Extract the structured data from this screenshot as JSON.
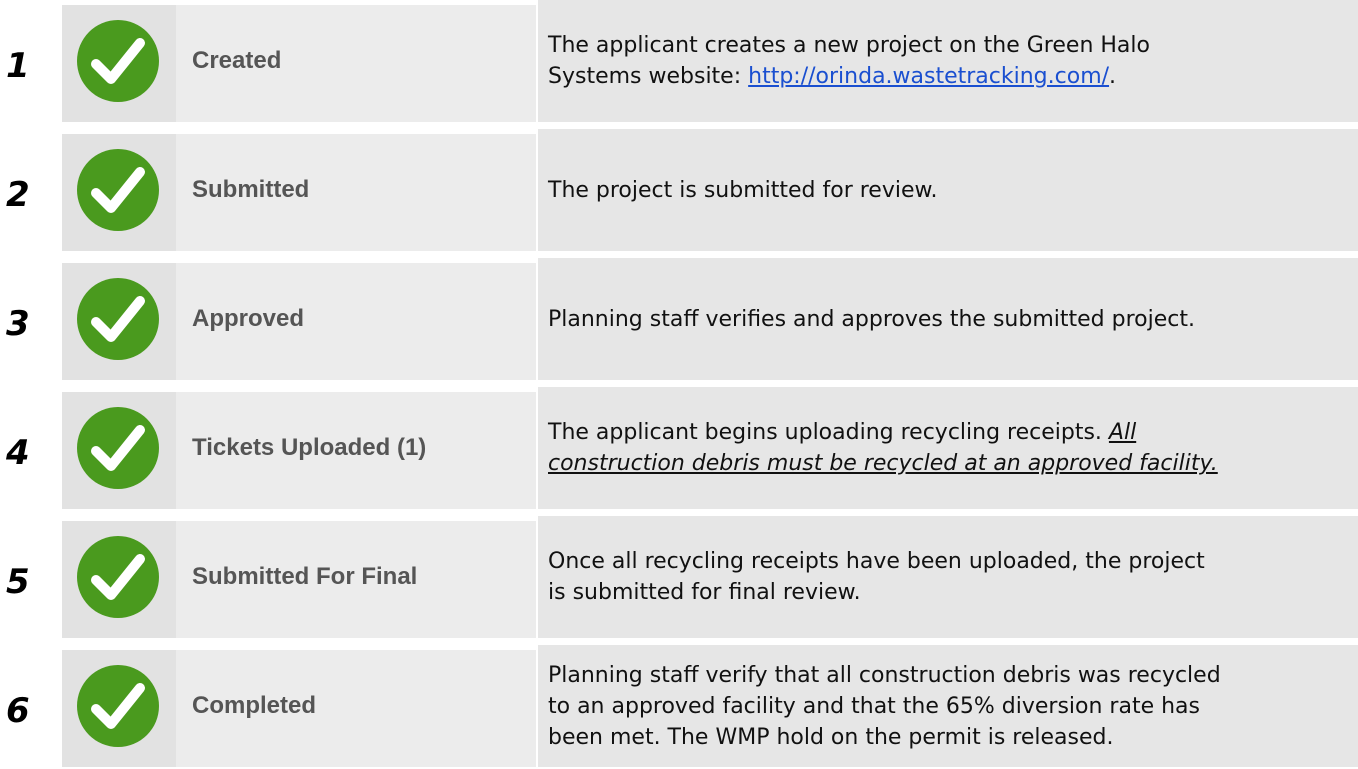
{
  "steps": [
    {
      "number": "1",
      "status": "Created",
      "description": {
        "line1": "The applicant creates a new project on the Green Halo",
        "line2_prefix": "Systems website: ",
        "link": "http://orinda.wastetracking.com/",
        "line2_suffix": "."
      }
    },
    {
      "number": "2",
      "status": "Submitted",
      "description": {
        "line1": "The project is submitted for review."
      }
    },
    {
      "number": "3",
      "status": "Approved",
      "description": {
        "line1": "Planning staff verifies and approves the submitted project."
      }
    },
    {
      "number": "4",
      "status": "Tickets Uploaded (1)",
      "description": {
        "line1_prefix": "The applicant begins uploading recycling receipts. ",
        "line1_emph": "All",
        "line2_emph": "construction debris must be recycled at an approved facility."
      }
    },
    {
      "number": "5",
      "status": "Submitted For Final",
      "description": {
        "line1": "Once all recycling receipts have been uploaded, the project",
        "line2": "is submitted for final review."
      }
    },
    {
      "number": "6",
      "status": "Completed",
      "description": {
        "line1": "Planning staff verify that all construction debris was recycled",
        "line2": "to an approved facility and that the 65% diversion rate has",
        "line3": "been met. The WMP hold on the permit is released."
      }
    }
  ],
  "icons": {
    "status_icon": "check-circle-icon"
  },
  "colors": {
    "check_green": "#4a9a1e",
    "status_text": "#555555",
    "link": "#1a4fd0"
  }
}
